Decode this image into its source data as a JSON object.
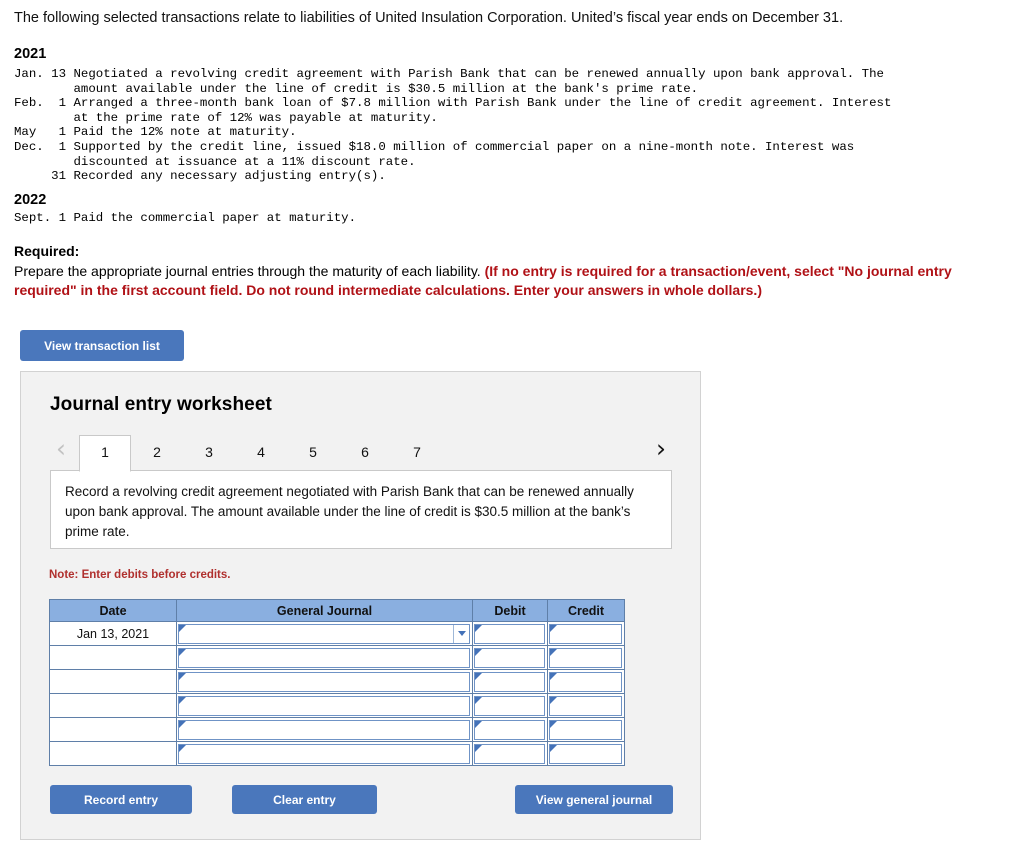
{
  "intro": "The following selected transactions relate to liabilities of United Insulation Corporation. United’s fiscal year ends on December 31.",
  "transactions": {
    "year_2021_label": "2021",
    "year_2021_text": "Jan. 13 Negotiated a revolving credit agreement with Parish Bank that can be renewed annually upon bank approval. The\n        amount available under the line of credit is $30.5 million at the bank's prime rate.\nFeb.  1 Arranged a three-month bank loan of $7.8 million with Parish Bank under the line of credit agreement. Interest\n        at the prime rate of 12% was payable at maturity.\nMay   1 Paid the 12% note at maturity.\nDec.  1 Supported by the credit line, issued $18.0 million of commercial paper on a nine-month note. Interest was\n        discounted at issuance at a 11% discount rate.\n     31 Recorded any necessary adjusting entry(s).",
    "year_2022_label": "2022",
    "year_2022_text": "Sept. 1 Paid the commercial paper at maturity."
  },
  "required": {
    "label": "Required:",
    "text_black": "Prepare the appropriate journal entries through the maturity of each liability. ",
    "text_red": "(If no entry is required for a transaction/event, select \"No journal entry required\" in the first account field. Do not round intermediate calculations. Enter your answers in whole dollars.)"
  },
  "buttons": {
    "view_transaction_list": "View transaction list",
    "record_entry": "Record entry",
    "clear_entry": "Clear entry",
    "view_general_journal": "View general journal"
  },
  "worksheet": {
    "title": "Journal entry worksheet",
    "prev_icon": "‹",
    "next_icon": "›",
    "tabs": [
      {
        "label": "1",
        "active": true
      },
      {
        "label": "2",
        "active": false
      },
      {
        "label": "3",
        "active": false
      },
      {
        "label": "4",
        "active": false
      },
      {
        "label": "5",
        "active": false
      },
      {
        "label": "6",
        "active": false
      },
      {
        "label": "7",
        "active": false
      }
    ],
    "description": "Record a revolving credit agreement negotiated with Parish Bank that can be renewed annually upon bank approval. The amount available under the line of credit is $30.5 million at the bank’s prime rate.",
    "note": "Note: Enter debits before credits."
  },
  "journal_table": {
    "headers": [
      "Date",
      "General Journal",
      "Debit",
      "Credit"
    ],
    "rows": [
      {
        "date": "Jan 13, 2021",
        "general_journal": "",
        "debit": "",
        "credit": "",
        "has_dropdown": true
      },
      {
        "date": "",
        "general_journal": "",
        "debit": "",
        "credit": "",
        "has_dropdown": false
      },
      {
        "date": "",
        "general_journal": "",
        "debit": "",
        "credit": "",
        "has_dropdown": false
      },
      {
        "date": "",
        "general_journal": "",
        "debit": "",
        "credit": "",
        "has_dropdown": false
      },
      {
        "date": "",
        "general_journal": "",
        "debit": "",
        "credit": "",
        "has_dropdown": false
      },
      {
        "date": "",
        "general_journal": "",
        "debit": "",
        "credit": "",
        "has_dropdown": false
      }
    ]
  },
  "colors": {
    "button_blue": "#4a77bc",
    "table_header_blue": "#8aafe0",
    "field_border_blue": "#6f93c6",
    "note_red": "#b0302e",
    "required_red": "#b01116",
    "panel_gray": "#f2f2f2"
  }
}
